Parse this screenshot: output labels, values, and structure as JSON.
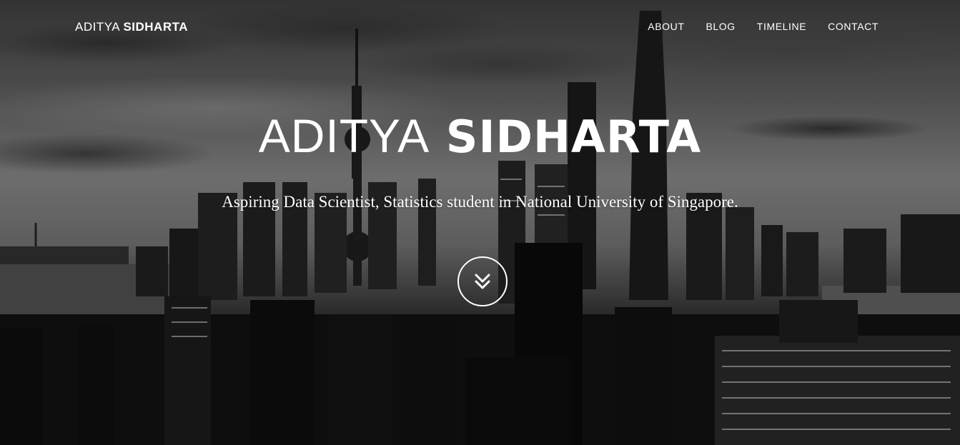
{
  "navbar": {
    "brand_first": "ADITYA",
    "brand_last": "SIDHARTA",
    "links": [
      "ABOUT",
      "BLOG",
      "TIMELINE",
      "CONTACT"
    ]
  },
  "hero": {
    "title_first": "ADITYA",
    "title_last": "SIDHARTA",
    "subtitle": "Aspiring Data Scientist, Statistics student in National University of Singapore.",
    "scroll_icon": "double-chevron-down-icon"
  }
}
